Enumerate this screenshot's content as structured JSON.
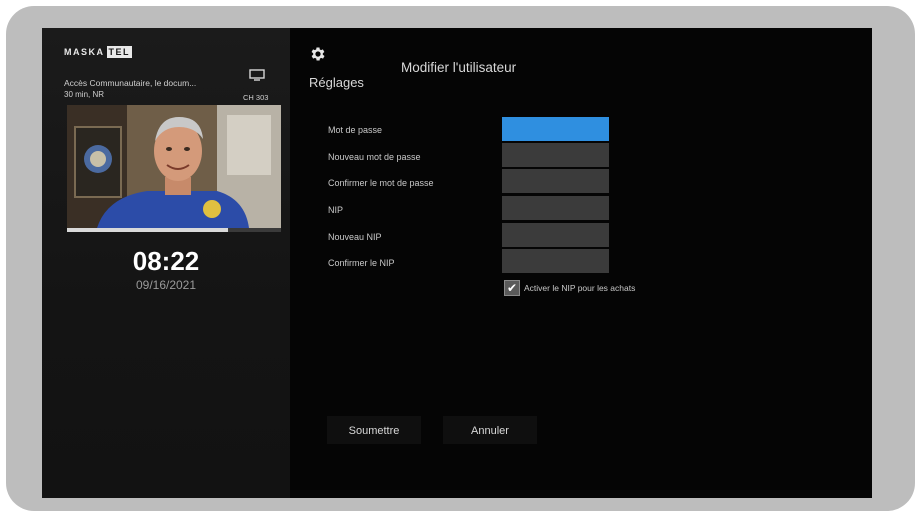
{
  "sidebar": {
    "logo": {
      "brand": "MASKA",
      "suffix": "TEL"
    },
    "program_title": "Accès Communautaire, le docum...",
    "program_meta": "30 min, NR",
    "channel": "CH 303",
    "progress_fraction": 0.75,
    "clock": "08:22",
    "date": "09/16/2021"
  },
  "header": {
    "settings_label": "Réglages",
    "page_title": "Modifier l'utilisateur"
  },
  "form": {
    "fields": [
      {
        "label": "Mot de passe",
        "value": "",
        "active": true
      },
      {
        "label": "Nouveau mot de passe",
        "value": "",
        "active": false
      },
      {
        "label": "Confirmer le mot de passe",
        "value": "",
        "active": false
      },
      {
        "label": "NIP",
        "value": "",
        "active": false
      },
      {
        "label": "Nouveau NIP",
        "value": "",
        "active": false
      },
      {
        "label": "Confirmer le NIP",
        "value": "",
        "active": false
      }
    ],
    "purchase_pin_checkbox": {
      "label": "Activer le NIP pour les achats",
      "checked": true
    }
  },
  "buttons": {
    "submit": "Soumettre",
    "cancel": "Annuler"
  },
  "colors": {
    "accent": "#2f8fe0",
    "field_bg": "#3b3b3b",
    "frame": "#bdbdbd",
    "screen_bg": "#050505"
  },
  "icons": {
    "settings": "gear-icon",
    "tv": "tv-icon",
    "check": "checkmark-icon"
  }
}
